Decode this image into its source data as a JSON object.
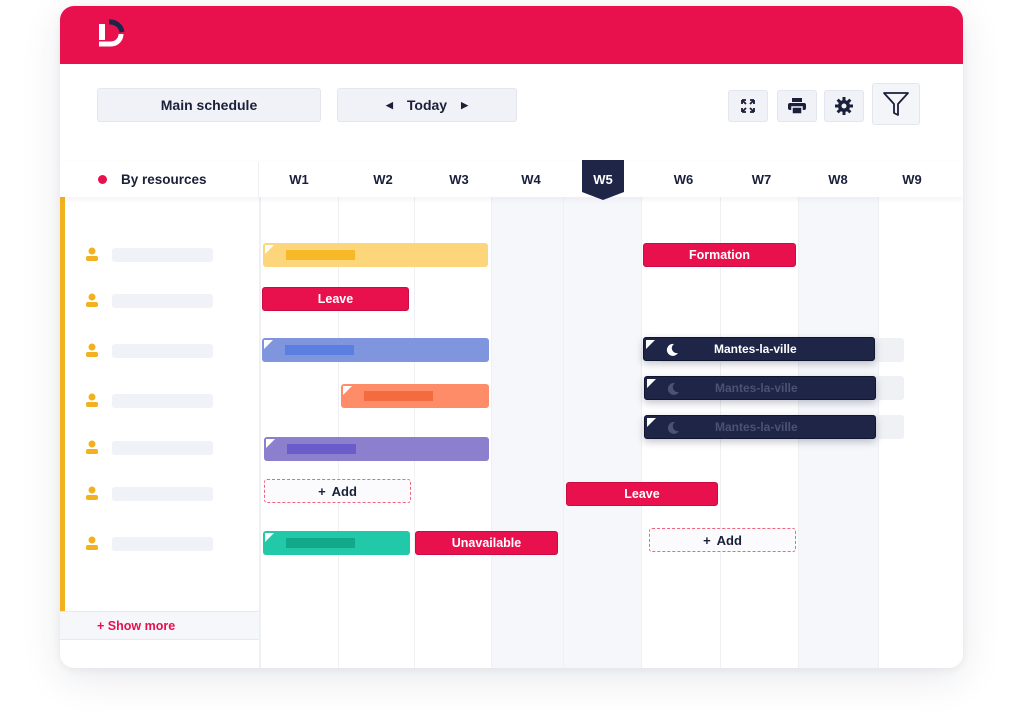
{
  "colors": {
    "brand": "#e8104d",
    "navy": "#1e2547",
    "accent_yellow": "#f2b21f",
    "yellow_bar": "#fdd57a",
    "yellow_inner": "#f7b928",
    "blue_bar": "#7f96de",
    "blue_inner": "#5b7fe0",
    "orange_bar": "#ff8c68",
    "orange_inner": "#f56b40",
    "purple_bar": "#8b7fce",
    "purple_inner": "#6a5cc9",
    "teal_bar": "#22c9a9",
    "teal_inner": "#12a98b"
  },
  "header": {
    "logo": "logo-d-icon"
  },
  "toolbar": {
    "main_schedule": "Main schedule",
    "today": "Today",
    "prev_icon": "◀",
    "next_icon": "▶",
    "icons": [
      "expand-icon",
      "print-icon",
      "settings-gear-icon",
      "filter-funnel-icon"
    ]
  },
  "grid": {
    "group_label": "By resources",
    "weeks": [
      "W1",
      "W2",
      "W3",
      "W4",
      "W5",
      "W6",
      "W7",
      "W8",
      "W9"
    ],
    "current_week": "W5",
    "shaded_weeks": [
      "W4",
      "W5",
      "W8"
    ]
  },
  "resources": [
    {
      "icon": "person-icon"
    },
    {
      "icon": "person-icon"
    },
    {
      "icon": "person-icon"
    },
    {
      "icon": "person-icon"
    },
    {
      "icon": "person-icon"
    },
    {
      "icon": "person-icon"
    },
    {
      "icon": "person-icon"
    }
  ],
  "events": {
    "formation": "Formation",
    "leave_1": "Leave",
    "leave_2": "Leave",
    "unavailable": "Unavailable",
    "mission_1": "Mantes-la-ville",
    "mission_2": "Mantes-la-ville",
    "mission_3": "Mantes-la-ville",
    "add_1": "Add",
    "add_2": "Add",
    "add_plus": "+"
  },
  "show_more": "+ Show more"
}
